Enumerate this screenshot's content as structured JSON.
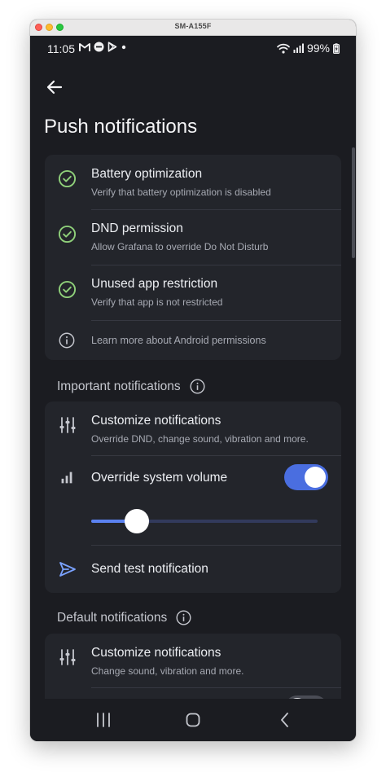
{
  "window": {
    "title": "SM-A155F"
  },
  "status_bar": {
    "time": "11:05",
    "battery": "99%"
  },
  "page": {
    "title": "Push notifications"
  },
  "permissions": [
    {
      "title": "Battery optimization",
      "subtitle": "Verify that battery optimization is disabled",
      "icon": "check-circle-icon"
    },
    {
      "title": "DND permission",
      "subtitle": "Allow Grafana to override Do Not Disturb",
      "icon": "check-circle-icon"
    },
    {
      "title": "Unused app restriction",
      "subtitle": "Verify that app is not restricted",
      "icon": "check-circle-icon"
    }
  ],
  "learn_more": "Learn more about Android permissions",
  "important": {
    "header": "Important notifications",
    "customize_title": "Customize notifications",
    "customize_sub": "Override DND, change sound, vibration and more.",
    "override_title": "Override system volume",
    "override_enabled": true,
    "volume_level": 0.2,
    "send_test": "Send test notification"
  },
  "default": {
    "header": "Default notifications",
    "customize_title": "Customize notifications",
    "customize_sub": "Change sound, vibration and more."
  },
  "colors": {
    "accent": "#4a6ee0",
    "check": "#8fd07a",
    "link": "#7aa2ff",
    "background": "#1b1c21",
    "card": "#23252b"
  }
}
